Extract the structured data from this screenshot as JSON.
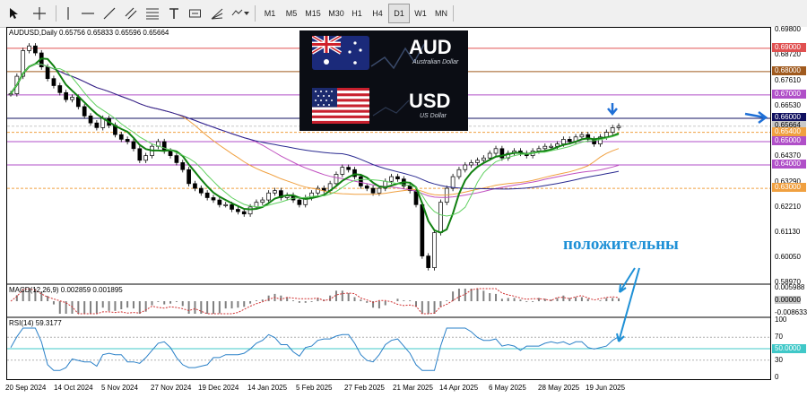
{
  "toolbar": {
    "tool_icons": [
      "cursor-icon",
      "crosshair-icon",
      "horizontal-line-icon",
      "trendline-icon",
      "channel-icon",
      "fibonacci-icon",
      "text-icon",
      "label-icon",
      "shapes-icon"
    ],
    "timeframes": [
      "M1",
      "M5",
      "M15",
      "M30",
      "H1",
      "H4",
      "D1",
      "W1",
      "MN"
    ],
    "active_timeframe": "D1"
  },
  "chart": {
    "symbol_caption": "AUDUSD,Daily  0.65756 0.65833 0.65596 0.65664",
    "macd_caption": "MACD(12,26,9) 0.002859 0.001895",
    "rsi_caption": "RSI(14) 59.3177"
  },
  "price_axis": {
    "ticks": [
      "0.69800",
      "0.68720",
      "0.67610",
      "0.66530",
      "0.65440",
      "0.64370",
      "0.63290",
      "0.62210",
      "0.61130",
      "0.60050",
      "0.58970"
    ],
    "level_labels": [
      {
        "text": "0.69000",
        "color": "#e05050"
      },
      {
        "text": "0.68000",
        "color": "#a05a1e"
      },
      {
        "text": "0.67000",
        "color": "#b04fc8"
      },
      {
        "text": "0.66000",
        "color": "#101060"
      },
      {
        "text": "0.65664",
        "color": "#c8c8c8"
      },
      {
        "text": "0.65400",
        "color": "#f0a040"
      },
      {
        "text": "0.65000",
        "color": "#b04fc8"
      },
      {
        "text": "0.64000",
        "color": "#b04fc8"
      },
      {
        "text": "0.63000",
        "color": "#f0a040"
      }
    ],
    "macd_ticks": [
      "0.005988",
      "0.00000",
      "-0.008633"
    ],
    "rsi_ticks": [
      "100",
      "70",
      "50.0000",
      "30",
      "0"
    ]
  },
  "time_axis": [
    "20 Sep 2024",
    "14 Oct 2024",
    "5 Nov 2024",
    "27 Nov 2024",
    "19 Dec 2024",
    "14 Jan 2025",
    "5 Feb 2025",
    "27 Feb 2025",
    "21 Mar 2025",
    "14 Apr 2025",
    "6 May 2025",
    "28 May 2025",
    "19 Jun 2025"
  ],
  "flag_panel": {
    "base_code": "AUD",
    "base_name": "Australian Dollar",
    "quote_code": "USD",
    "quote_name": "US Dollar"
  },
  "annotation": {
    "text": "положительны",
    "color": "#1e90d6"
  },
  "chart_data": {
    "type": "line",
    "series": [
      {
        "values": [
          0.6705,
          0.678,
          0.689,
          0.691,
          0.688,
          0.682,
          0.677,
          0.674,
          0.671,
          0.668,
          0.669,
          0.665,
          0.661,
          0.658,
          0.656,
          0.66,
          0.657,
          0.653,
          0.651,
          0.65,
          0.647,
          0.642,
          0.644,
          0.648,
          0.65,
          0.646,
          0.644,
          0.641,
          0.638,
          0.632,
          0.63,
          0.628,
          0.626,
          0.625,
          0.623,
          0.623,
          0.621,
          0.62,
          0.619,
          0.622,
          0.624,
          0.625,
          0.628,
          0.629,
          0.626,
          0.627,
          0.625,
          0.623,
          0.626,
          0.628,
          0.63,
          0.629,
          0.632,
          0.636,
          0.639,
          0.638,
          0.635,
          0.631,
          0.63,
          0.628,
          0.63,
          0.633,
          0.635,
          0.634,
          0.631,
          0.629,
          0.623,
          0.601,
          0.596,
          0.611,
          0.624,
          0.63,
          0.635,
          0.638,
          0.64,
          0.641,
          0.642,
          0.643,
          0.645,
          0.647,
          0.643,
          0.645,
          0.646,
          0.645,
          0.644,
          0.646,
          0.647,
          0.648,
          0.648,
          0.649,
          0.651,
          0.65,
          0.652,
          0.653,
          0.651,
          0.649,
          0.652,
          0.654,
          0.656,
          0.6566
        ]
      }
    ],
    "horizontal_levels": [
      0.69,
      0.68,
      0.67,
      0.66,
      0.654,
      0.65,
      0.64,
      0.63
    ],
    "ylim": [
      0.5897,
      0.698
    ]
  }
}
